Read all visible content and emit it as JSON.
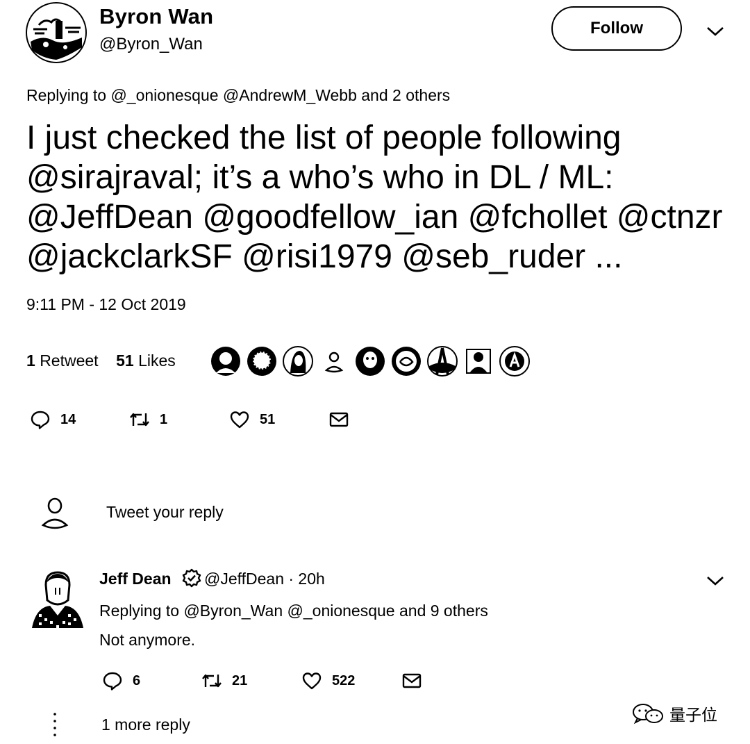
{
  "tweet": {
    "author_name": "Byron Wan",
    "author_handle": "@Byron_Wan",
    "follow_label": "Follow",
    "replying_to": "Replying to @_onionesque @AndrewM_Webb and 2 others",
    "text_lines": [
      "I just checked the list of people following",
      "@sirajraval; it’s a who’s who in DL / ML:",
      "@JeffDean @goodfellow_ian @fchollet @ctnzr",
      "@jackclarkSF @risi1979 @seb_ruder ..."
    ],
    "timestamp": "9:11 PM - 12 Oct 2019",
    "retweets_count": "1",
    "retweets_label": "Retweet",
    "likes_count": "51",
    "likes_label": "Likes",
    "liker_avatars": [
      "avatar-1",
      "avatar-2",
      "avatar-3",
      "avatar-4",
      "avatar-5",
      "avatar-6",
      "avatar-7",
      "avatar-8",
      "avatar-9"
    ],
    "actions": {
      "reply_count": "14",
      "retweet_count": "1",
      "like_count": "51"
    }
  },
  "compose": {
    "placeholder": "Tweet your reply"
  },
  "reply": {
    "author_name": "Jeff Dean",
    "verified_icon": "verified-badge-icon",
    "handle_time": "@JeffDean · 20h",
    "replying_to": "Replying to @Byron_Wan @_onionesque and 9 others",
    "text": "Not anymore.",
    "actions": {
      "reply_count": "6",
      "retweet_count": "21",
      "like_count": "522"
    }
  },
  "more_replies": "1 more reply",
  "watermark": "量子位"
}
